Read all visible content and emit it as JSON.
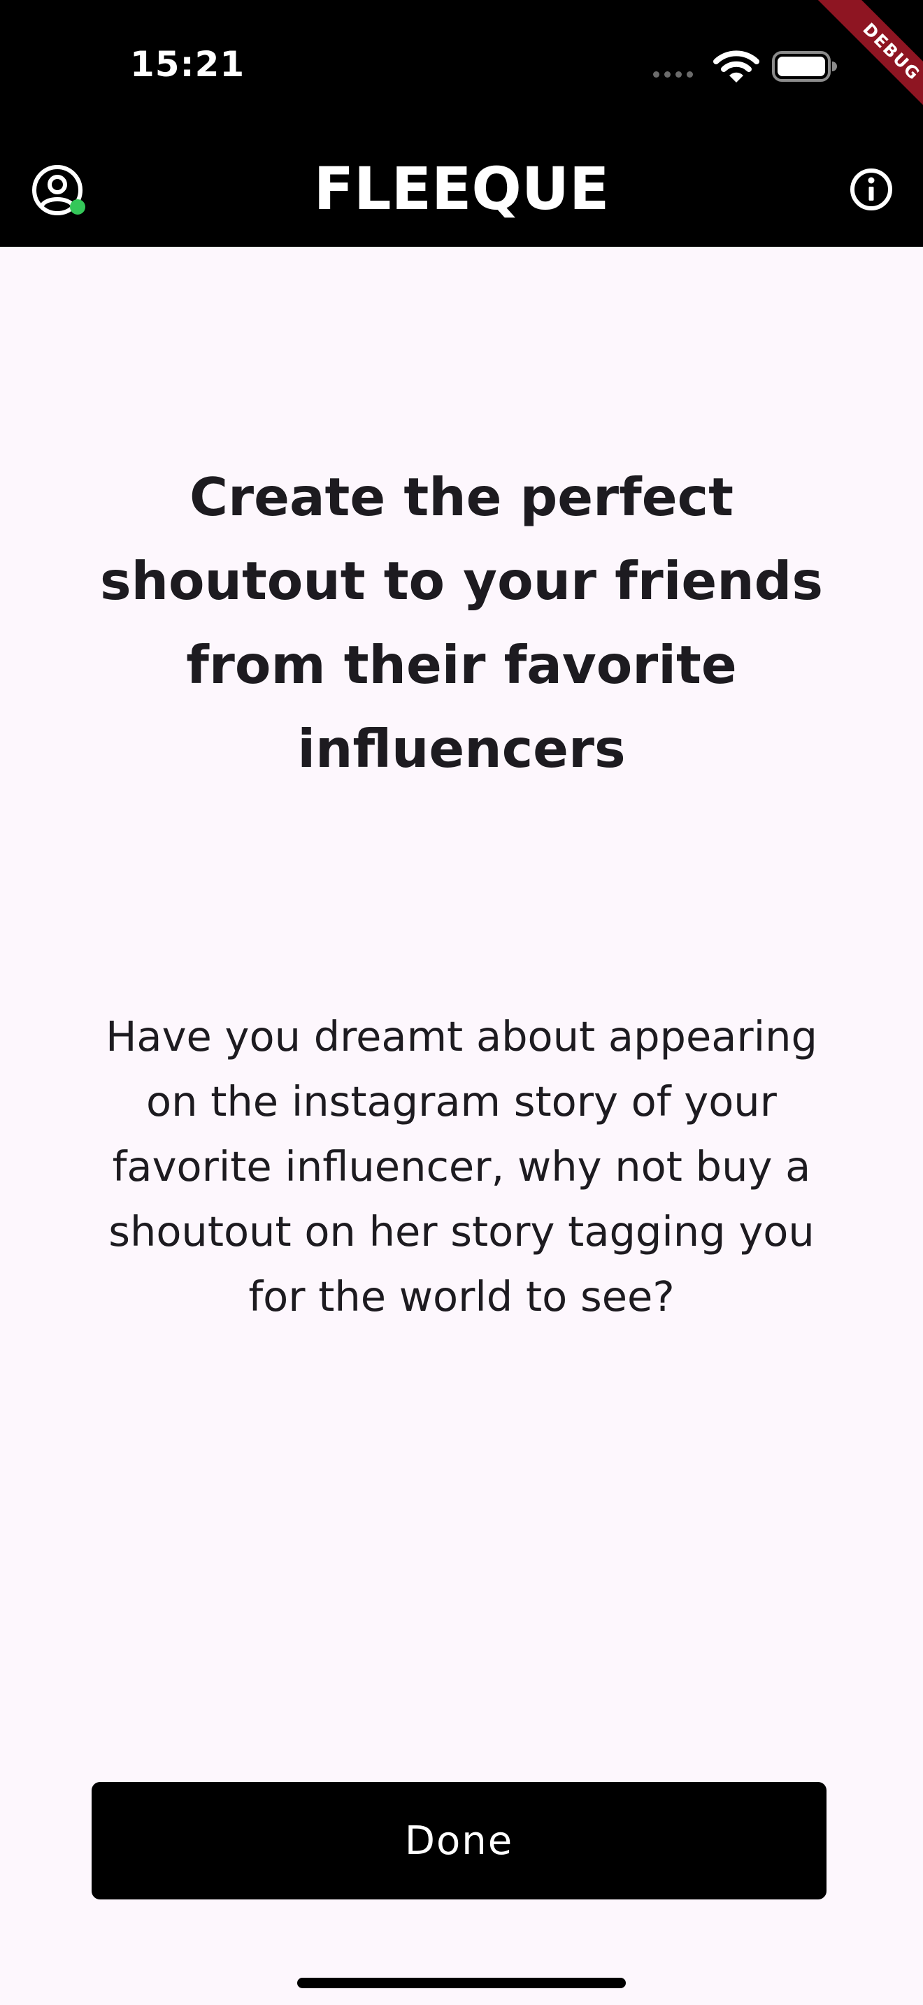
{
  "status_bar": {
    "time": "15:21",
    "icons": [
      "cellular-signal-icon",
      "wifi-icon",
      "battery-icon"
    ]
  },
  "debug_banner": {
    "label": "DEBUG",
    "color": "#8e1522"
  },
  "app_bar": {
    "title": "FLEEQUE",
    "leading_icon": "user-circle-icon",
    "online_status_color": "#34c759",
    "trailing_icon": "info-icon"
  },
  "content": {
    "headline": "Create the perfect shoutout to your friends from their favorite influencers",
    "description": "Have you dreamt about appearing on the instagram story of your favorite influencer, why not buy a shoutout on her story tagging you for the world to see?"
  },
  "actions": {
    "done_label": "Done"
  },
  "colors": {
    "app_bar_background": "#000000",
    "page_background": "#fdf7fd",
    "text": "#1d1b20",
    "button_background": "#000000",
    "button_text": "#ffffff"
  }
}
